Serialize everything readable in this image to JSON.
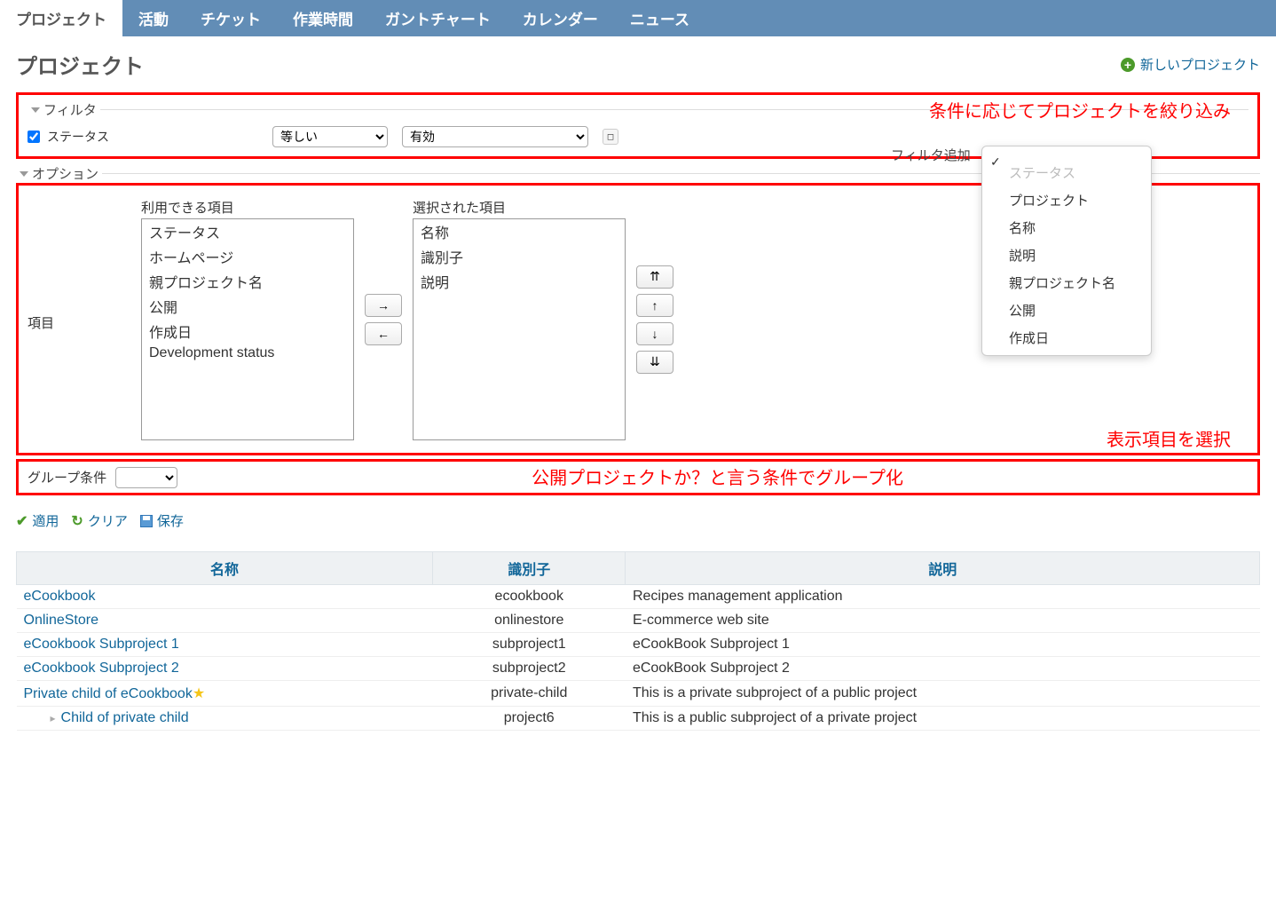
{
  "tabs": [
    {
      "label": "プロジェクト",
      "active": true
    },
    {
      "label": "活動"
    },
    {
      "label": "チケット"
    },
    {
      "label": "作業時間"
    },
    {
      "label": "ガントチャート"
    },
    {
      "label": "カレンダー"
    },
    {
      "label": "ニュース"
    }
  ],
  "page_title": "プロジェクト",
  "new_project_label": "新しいプロジェクト",
  "filters_legend": "フィルタ",
  "options_legend": "オプション",
  "status_label": "ステータス",
  "operator_options": [
    "等しい"
  ],
  "operator_value": "等しい",
  "value_options": [
    "有効"
  ],
  "value_value": "有効",
  "filter_add_label": "フィルタ追加",
  "dropdown_items": [
    {
      "label": "",
      "checked": true,
      "disabled": false
    },
    {
      "label": "ステータス",
      "disabled": true
    },
    {
      "label": "プロジェクト"
    },
    {
      "label": "名称"
    },
    {
      "label": "説明"
    },
    {
      "label": "親プロジェクト名"
    },
    {
      "label": "公開"
    },
    {
      "label": "作成日"
    }
  ],
  "annotations": {
    "filter": "条件に応じてプロジェクトを絞り込み",
    "columns": "表示項目を選択",
    "group": "公開プロジェクトか？と言う条件でグループ化"
  },
  "columns_label": "項目",
  "available_label": "利用できる項目",
  "selected_label": "選択された項目",
  "available_items": [
    "ステータス",
    "ホームページ",
    "親プロジェクト名",
    "公開",
    "作成日",
    "Development status"
  ],
  "selected_items": [
    "名称",
    "識別子",
    "説明"
  ],
  "group_by_label": "グループ条件",
  "apply_label": "適用",
  "clear_label": "クリア",
  "save_label": "保存",
  "table": {
    "headers": [
      "名称",
      "識別子",
      "説明"
    ],
    "rows": [
      {
        "name": "eCookbook",
        "identifier": "ecookbook",
        "description": "Recipes management application",
        "star": false,
        "child": false
      },
      {
        "name": "OnlineStore",
        "identifier": "onlinestore",
        "description": "E-commerce web site",
        "star": false,
        "child": false
      },
      {
        "name": "eCookbook Subproject 1",
        "identifier": "subproject1",
        "description": "eCookBook Subproject 1",
        "star": false,
        "child": false
      },
      {
        "name": "eCookbook Subproject 2",
        "identifier": "subproject2",
        "description": "eCookBook Subproject 2",
        "star": false,
        "child": false
      },
      {
        "name": "Private child of eCookbook",
        "identifier": "private-child",
        "description": "This is a private subproject of a public project",
        "star": true,
        "child": false
      },
      {
        "name": "Child of private child",
        "identifier": "project6",
        "description": "This is a public subproject of a private project",
        "star": false,
        "child": true
      }
    ]
  }
}
